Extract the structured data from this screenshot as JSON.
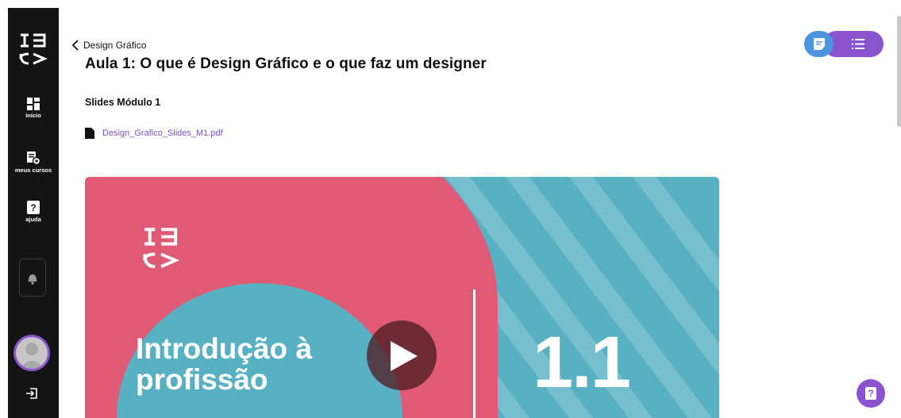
{
  "sidebar": {
    "logo_icon": "ebac-logo-icon",
    "items": [
      {
        "label": "início",
        "icon": "dashboard-icon"
      },
      {
        "label": "meus cursos",
        "icon": "courses-icon"
      },
      {
        "label": "ajuda",
        "icon": "help-icon"
      }
    ],
    "notifications_icon": "bell-icon",
    "logout_icon": "logout-icon"
  },
  "header": {
    "breadcrumb": "Design Gráfico",
    "title": "Aula 1: O que é Design Gráfico e o que faz um designer"
  },
  "content": {
    "section_title": "Slides Módulo 1",
    "file_name": "Design_Grafico_Slides_M1.pdf"
  },
  "video": {
    "title_line1": "Introdução à",
    "title_line2": "profissão",
    "number": "1.1"
  },
  "toggle": {
    "left_icon": "notes-icon",
    "right_icon": "list-icon"
  },
  "help_button": {
    "label": "?"
  },
  "colors": {
    "sidebar_bg": "#141414",
    "accent_purple": "#8a54cf",
    "accent_blue": "#4d94e0",
    "video_teal": "#58b1c3",
    "video_pink": "#e05a76"
  }
}
